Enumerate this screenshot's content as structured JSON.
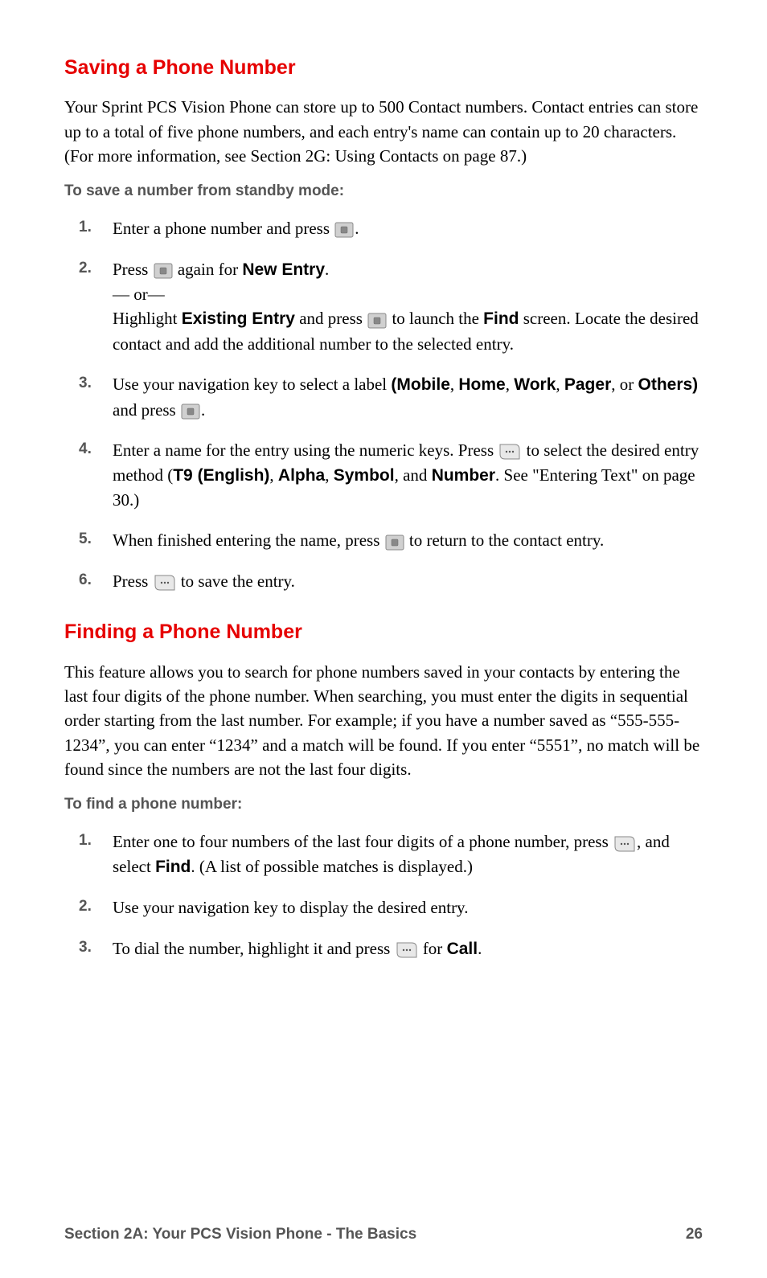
{
  "heading1": "Saving a Phone Number",
  "para1": "Your Sprint PCS Vision Phone can store up to 500 Contact numbers. Contact entries can store up to a total of five phone numbers, and each entry's name can contain up to 20 characters. (For more information, see Section 2G: Using Contacts on page 87.)",
  "sub1": "To save a number from standby mode:",
  "s1n1": "1.",
  "s1_1a": "Enter a phone number and press ",
  "s1_1b": ".",
  "s1n2": "2.",
  "s1_2a": "Press ",
  "s1_2b": " again for ",
  "s1_2c": "New Entry",
  "s1_2d": ".",
  "s1_2e": "— or—",
  "s1_2f": "Highlight ",
  "s1_2g": "Existing Entry",
  "s1_2h": " and press ",
  "s1_2i": " to launch the ",
  "s1_2j": "Find",
  "s1_2k": " screen. Locate the desired contact and add the additional number to the selected entry.",
  "s1n3": "3.",
  "s1_3a": "Use your navigation key to select a label ",
  "s1_3b": "(Mobile",
  "s1_3c": ", ",
  "s1_3d": "Home",
  "s1_3e": ", ",
  "s1_3f": "Work",
  "s1_3g": ", ",
  "s1_3h": "Pager",
  "s1_3i": ", or ",
  "s1_3j": "Others)",
  "s1_3k": " and press ",
  "s1_3l": ".",
  "s1n4": "4.",
  "s1_4a": "Enter a name for the entry using the numeric keys. Press ",
  "s1_4b": " to select the desired entry method (",
  "s1_4c": "T9 (English)",
  "s1_4d": ", ",
  "s1_4e": "Alpha",
  "s1_4f": ", ",
  "s1_4g": "Symbol",
  "s1_4h": ", and ",
  "s1_4i": "Number",
  "s1_4j": ". See \"Entering Text\" on page 30.)",
  "s1n5": "5.",
  "s1_5a": "When finished entering the name, press ",
  "s1_5b": " to return to the contact entry.",
  "s1n6": "6.",
  "s1_6a": "Press ",
  "s1_6b": " to save the entry.",
  "heading2": "Finding a Phone Number",
  "para2": "This feature allows you to search for phone numbers saved in your contacts by entering the last four digits of the phone number. When searching, you must enter the digits in sequential order starting from the last number. For example; if you have a number saved as “555-555-1234”, you can enter “1234” and a match will be found. If you enter “5551”, no match will be found since the numbers are not the last four digits.",
  "sub2": "To find a phone number:",
  "f1n1": "1.",
  "f1_1a": " Enter one to four numbers of the last four digits of a phone number, press ",
  "f1_1b": ", and select ",
  "f1_1c": "Find",
  "f1_1d": ". (A list of possible matches is displayed.)",
  "f1n2": "2.",
  "f1_2a": "Use your navigation key to display the desired entry.",
  "f1n3": "3.",
  "f1_3a": "To dial the number, highlight it and press ",
  "f1_3b": " for ",
  "f1_3c": "Call",
  "f1_3d": ".",
  "footer_section": "Section 2A: Your PCS Vision Phone - The Basics",
  "footer_page": "26"
}
